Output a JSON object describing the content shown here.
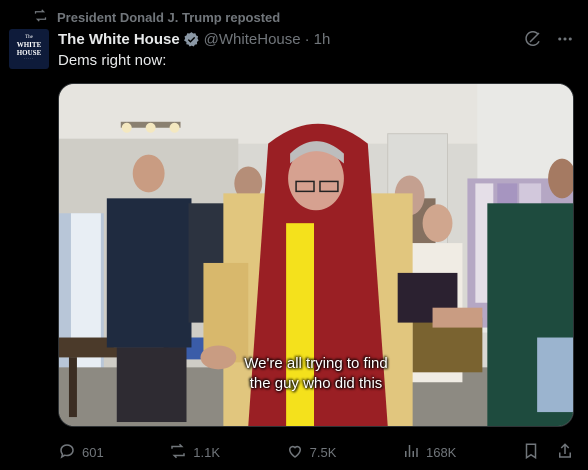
{
  "repost": {
    "icon": "repost-icon",
    "text": "President Donald J. Trump reposted"
  },
  "avatar": {
    "line1": "The",
    "line2": "WHITE HOUSE",
    "line3": "·····"
  },
  "tweet": {
    "author_name": "The White House",
    "handle": "@WhiteHouse",
    "separator": "·",
    "time": "1h",
    "text": "Dems right now:",
    "verified_color": "#8b98a5"
  },
  "media": {
    "subtitle_line1": "We're all trying to find",
    "subtitle_line2": "the guy who did this"
  },
  "actions": {
    "replies": "601",
    "reposts": "1.1K",
    "likes": "7.5K",
    "views": "168K"
  },
  "icons": [
    "repost-icon",
    "verified-icon",
    "grok-icon",
    "more-icon",
    "reply-icon",
    "retweet-icon",
    "like-icon",
    "views-icon",
    "bookmark-icon",
    "share-icon"
  ]
}
